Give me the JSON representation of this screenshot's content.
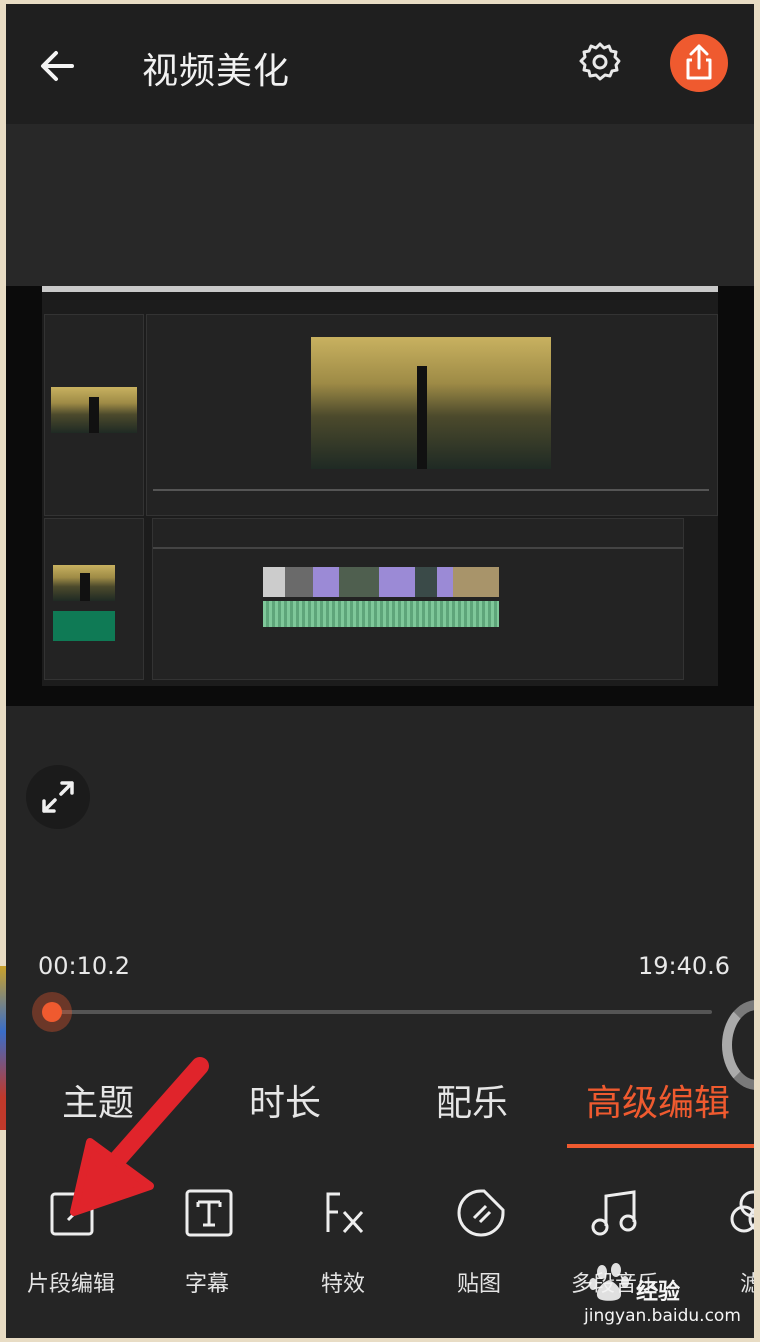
{
  "header": {
    "back_icon": "arrow-left-icon",
    "title": "视频美化",
    "settings_icon": "gear-icon",
    "share_icon": "share-upload-icon"
  },
  "player": {
    "expand_icon": "fullscreen-expand-icon",
    "current_time": "00:10.2",
    "total_time": "19:40.6",
    "progress": 0.009
  },
  "tabs": [
    {
      "label": "主题",
      "active": false
    },
    {
      "label": "时长",
      "active": false
    },
    {
      "label": "配乐",
      "active": false
    },
    {
      "label": "高级编辑",
      "active": true
    }
  ],
  "tools": [
    {
      "label": "片段编辑",
      "icon": "clip-edit-icon"
    },
    {
      "label": "字幕",
      "icon": "text-icon"
    },
    {
      "label": "特效",
      "icon": "fx-icon"
    },
    {
      "label": "贴图",
      "icon": "sticker-icon"
    },
    {
      "label": "多段音乐",
      "icon": "music-note-icon"
    },
    {
      "label": "滤",
      "icon": "filter-icon"
    }
  ],
  "colors": {
    "accent": "#ef5a2f",
    "background": "#252525",
    "arrow": "#e0242b"
  },
  "watermark": {
    "text": "经验",
    "url": "jingyan.baidu.com"
  }
}
